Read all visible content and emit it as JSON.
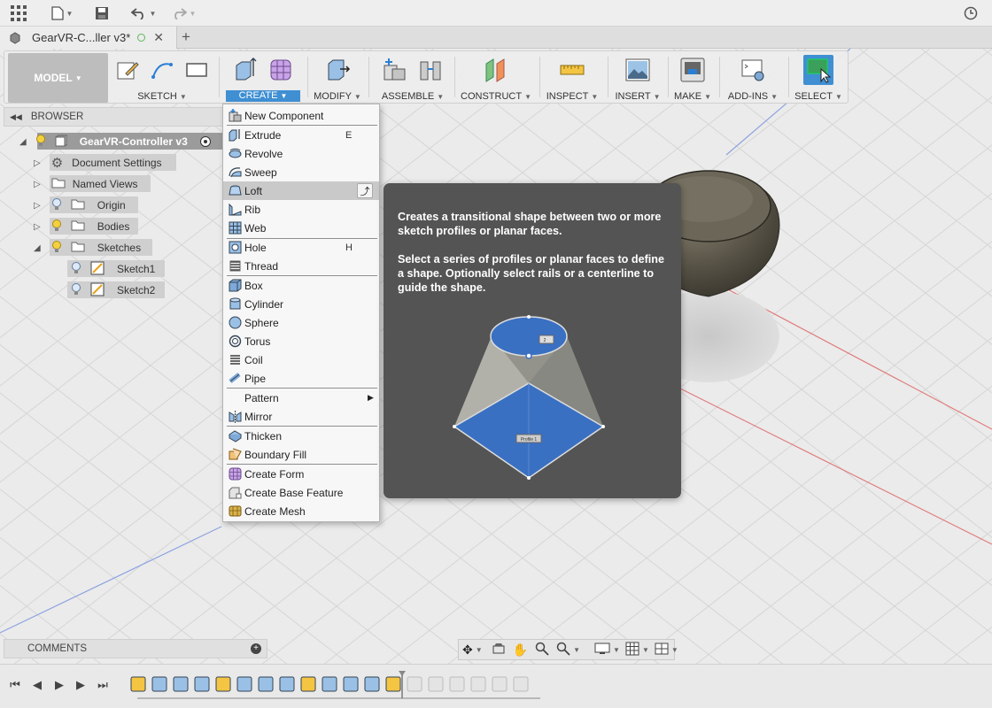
{
  "document": {
    "tab_title": "GearVR-C...ller v3*"
  },
  "toolbar": {
    "model_label": "MODEL",
    "groups": [
      {
        "label": "SKETCH"
      },
      {
        "label": "CREATE"
      },
      {
        "label": "MODIFY"
      },
      {
        "label": "ASSEMBLE"
      },
      {
        "label": "CONSTRUCT"
      },
      {
        "label": "INSPECT"
      },
      {
        "label": "INSERT"
      },
      {
        "label": "MAKE"
      },
      {
        "label": "ADD-INS"
      },
      {
        "label": "SELECT"
      }
    ]
  },
  "browser": {
    "title": "BROWSER",
    "root": "GearVR-Controller v3",
    "items": [
      {
        "label": "Document Settings"
      },
      {
        "label": "Named Views"
      },
      {
        "label": "Origin"
      },
      {
        "label": "Bodies"
      },
      {
        "label": "Sketches"
      },
      {
        "label": "Sketch1"
      },
      {
        "label": "Sketch2"
      }
    ]
  },
  "create_menu": {
    "items": [
      {
        "label": "New Component",
        "shortcut": ""
      },
      {
        "label": "Extrude",
        "shortcut": "E"
      },
      {
        "label": "Revolve",
        "shortcut": ""
      },
      {
        "label": "Sweep",
        "shortcut": ""
      },
      {
        "label": "Loft",
        "shortcut": ""
      },
      {
        "label": "Rib",
        "shortcut": ""
      },
      {
        "label": "Web",
        "shortcut": ""
      },
      {
        "label": "Hole",
        "shortcut": "H"
      },
      {
        "label": "Thread",
        "shortcut": ""
      },
      {
        "label": "Box",
        "shortcut": ""
      },
      {
        "label": "Cylinder",
        "shortcut": ""
      },
      {
        "label": "Sphere",
        "shortcut": ""
      },
      {
        "label": "Torus",
        "shortcut": ""
      },
      {
        "label": "Coil",
        "shortcut": ""
      },
      {
        "label": "Pipe",
        "shortcut": ""
      },
      {
        "label": "Pattern",
        "shortcut": ""
      },
      {
        "label": "Mirror",
        "shortcut": ""
      },
      {
        "label": "Thicken",
        "shortcut": ""
      },
      {
        "label": "Boundary Fill",
        "shortcut": ""
      },
      {
        "label": "Create Form",
        "shortcut": ""
      },
      {
        "label": "Create Base Feature",
        "shortcut": ""
      },
      {
        "label": "Create Mesh",
        "shortcut": ""
      }
    ]
  },
  "tooltip": {
    "line1": "Creates a transitional shape between two or more sketch profiles or planar faces.",
    "line2": "Select a series of profiles or planar faces to define a shape. Optionally select rails or a centerline to guide the shape.",
    "profile_label": "Profile 1",
    "profile2_label": "2"
  },
  "comments": {
    "title": "COMMENTS"
  },
  "colors": {
    "accent": "#3f8fd2",
    "tooltip_bg": "#545454",
    "grid_red": "#d84a4a",
    "grid_blue": "#4a6fd8"
  }
}
